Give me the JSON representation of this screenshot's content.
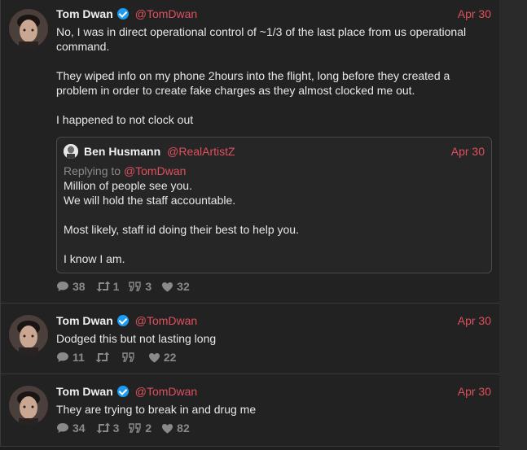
{
  "tweets": [
    {
      "name": "Tom Dwan",
      "handle": "@TomDwan",
      "date": "Apr 30",
      "text": "No, I was in direct operational control of ~1/3 of the last place from us operational command.\n\nThey wiped info on my phone 2hours into the flight, long before they created a problem in order to create fake charges as they almost clocked me out.\n\nI happened to not clock out",
      "quote": {
        "name": "Ben Husmann",
        "handle": "@RealArtistZ",
        "date": "Apr 30",
        "replying_label": "Replying to ",
        "replying_handle": "@TomDwan",
        "text": "Million of people see you.\nWe will hold the staff accountable.\n\nMost likely, staff id doing their best to help you.\n\nI know I am."
      },
      "replies": "38",
      "retweets": "1",
      "quotes": "3",
      "likes": "32"
    },
    {
      "name": "Tom Dwan",
      "handle": "@TomDwan",
      "date": "Apr 30",
      "text": "Dodged this but not lasting long",
      "replies": "11",
      "retweets": "",
      "quotes": "",
      "likes": "22"
    },
    {
      "name": "Tom Dwan",
      "handle": "@TomDwan",
      "date": "Apr 30",
      "text": "They are trying to break in and drug me",
      "replies": "34",
      "retweets": "3",
      "quotes": "2",
      "likes": "82"
    }
  ],
  "icons": {
    "reply": "speech-bubble-icon",
    "retweet": "retweet-icon",
    "quote": "quote-marks-icon",
    "like": "heart-icon",
    "verified": "verified-badge-icon"
  },
  "colors": {
    "background": "#1e1e1e",
    "accent": "#e0505e",
    "muted": "#8a8a8a",
    "verified": "#1d9bf0"
  }
}
